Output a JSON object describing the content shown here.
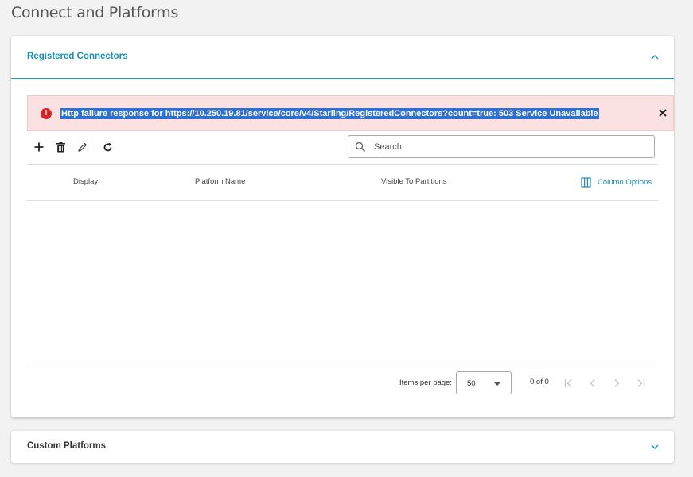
{
  "page": {
    "title": "Connect and Platforms"
  },
  "registered_connectors": {
    "title": "Registered Connectors",
    "expanded": true,
    "error": {
      "message": "Http failure response for https://10.250.19.81/service/core/v4/Starling/RegisteredConnectors?count=true: 503 Service Unavailable",
      "icon": "exclamation-circle-icon",
      "color": "#d8222a"
    },
    "toolbar": {
      "icons": [
        "add-icon",
        "delete-icon",
        "edit-icon",
        "refresh-icon"
      ]
    },
    "search": {
      "placeholder": "Search",
      "value": ""
    },
    "table": {
      "columns": [
        "Display",
        "Platform Name",
        "Visible To Partitions"
      ],
      "column_options_label": "Column Options",
      "rows": []
    },
    "pagination": {
      "items_per_page_label": "Items per page:",
      "items_per_page": "50",
      "range": "0 of 0"
    }
  },
  "custom_platforms": {
    "title": "Custom Platforms",
    "expanded": false
  },
  "colors": {
    "accent": "#1a8fb0",
    "error_bg": "#fbe1e1",
    "selection": "#2f6fd0"
  }
}
